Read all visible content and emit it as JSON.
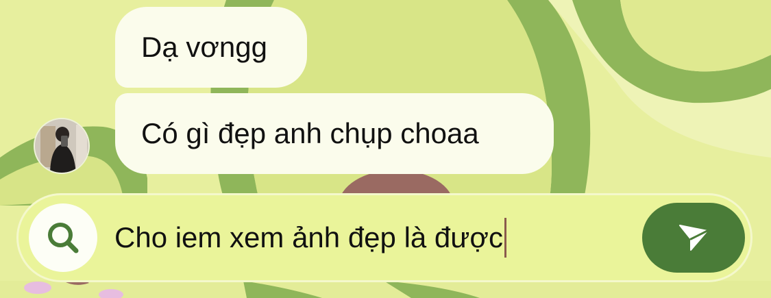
{
  "chat": {
    "messages": [
      {
        "text": "Dạ vơngg"
      },
      {
        "text": "Có gì đẹp anh chụp choaa"
      }
    ],
    "contact_avatar_icon": "profile-photo-mirror-selfie"
  },
  "composer": {
    "input_value": "Cho iem xem ảnh đẹp là được",
    "search_icon": "search-icon",
    "send_icon": "paper-plane-icon",
    "accent_color": "#4a7c38"
  },
  "theme": {
    "background_color": "#e6ee9c",
    "pattern": "avocado"
  }
}
